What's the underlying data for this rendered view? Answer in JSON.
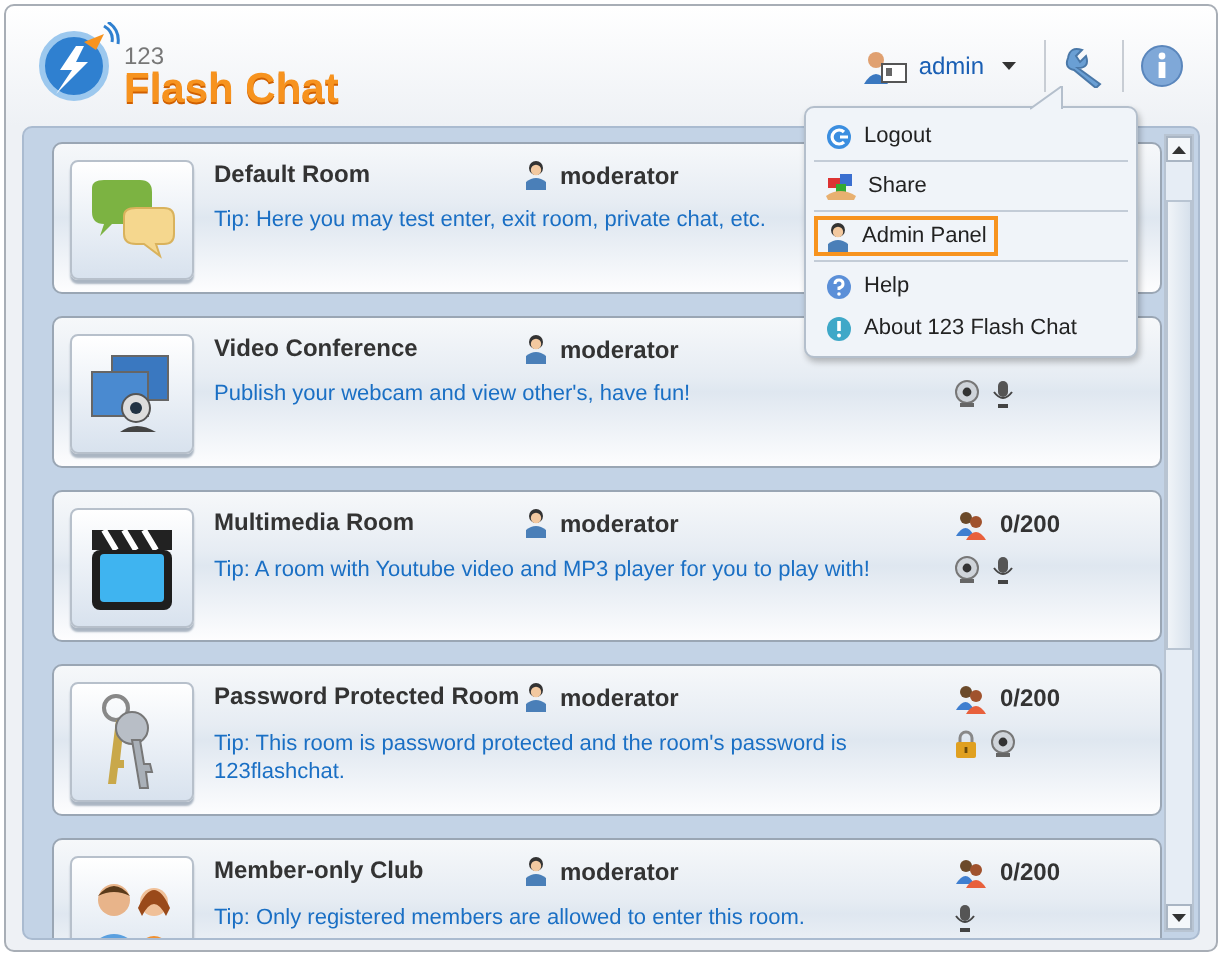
{
  "header": {
    "logo": {
      "number": "123",
      "name": "Flash Chat"
    },
    "user": {
      "name": "admin"
    }
  },
  "rooms": [
    {
      "kind": "chat",
      "name": "Default Room",
      "owner": "moderator",
      "tip": "Tip: Here you may test enter, exit room, private chat, etc."
    },
    {
      "kind": "video",
      "name": "Video Conference",
      "owner": "moderator",
      "tip": "Publish your webcam and view other's, have fun!",
      "features": [
        {
          "kind": "webcam"
        },
        {
          "kind": "mic"
        }
      ]
    },
    {
      "kind": "clapper",
      "name": "Multimedia Room",
      "owner": "moderator",
      "count": "0/200",
      "tip": "Tip: A room with Youtube video and MP3 player for you to play with!",
      "features": [
        {
          "kind": "webcam"
        },
        {
          "kind": "mic"
        }
      ]
    },
    {
      "kind": "keys",
      "name": "Password Protected Room",
      "owner": "moderator",
      "count": "0/200",
      "tip": "Tip: This room is password protected and the room's password is 123flashchat.",
      "features": [
        {
          "kind": "lock"
        },
        {
          "kind": "webcam"
        }
      ]
    },
    {
      "kind": "members",
      "name": "Member-only Club",
      "owner": "moderator",
      "count": "0/200",
      "tip": "Tip: Only registered members are allowed to enter this room.",
      "features": [
        {
          "kind": "mic"
        }
      ]
    }
  ],
  "menu": {
    "groups": [
      [
        {
          "kind": "logout",
          "label": "Logout",
          "selected": false
        }
      ],
      [
        {
          "kind": "share",
          "label": "Share",
          "selected": false
        }
      ],
      [
        {
          "kind": "admin",
          "label": "Admin Panel",
          "selected": true
        }
      ],
      [
        {
          "kind": "help",
          "label": "Help",
          "selected": false
        },
        {
          "kind": "about",
          "label": "About 123 Flash Chat",
          "selected": false
        }
      ]
    ]
  }
}
